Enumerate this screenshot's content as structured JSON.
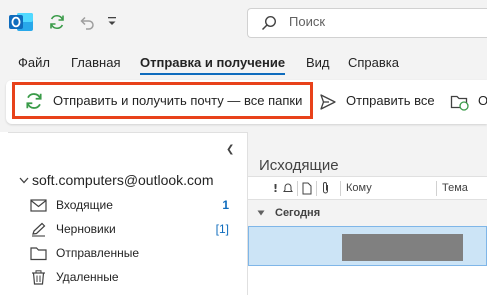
{
  "colors": {
    "accent": "#0f6cbd",
    "highlight": "#e8411a",
    "selection": "#cce4f6",
    "sync_green": "#3a9b49",
    "outlook_blue": "#0f6cbd"
  },
  "titlebar": {
    "icons": [
      "outlook-logo-icon",
      "sync-icon",
      "undo-icon",
      "customize-toolbar-icon"
    ],
    "search_placeholder": "Поиск"
  },
  "menu": {
    "tabs": [
      {
        "label": "Файл",
        "active": false
      },
      {
        "label": "Главная",
        "active": false
      },
      {
        "label": "Отправка и получение",
        "active": true
      },
      {
        "label": "Вид",
        "active": false
      },
      {
        "label": "Справка",
        "active": false
      }
    ]
  },
  "ribbon": {
    "send_receive_all": "Отправить и получить почту — все папки",
    "send_all": "Отправить все",
    "update_folder": "О"
  },
  "nav": {
    "account": "soft.computers@outlook.com",
    "folders": [
      {
        "label": "Входящие",
        "count": "1",
        "icon": "envelope-icon"
      },
      {
        "label": "Черновики",
        "count": "[1]",
        "icon": "pencil-icon"
      },
      {
        "label": "Отправленные",
        "count": "",
        "icon": "folder-icon"
      },
      {
        "label": "Удаленные",
        "count": "",
        "icon": "trash-icon"
      }
    ]
  },
  "mail": {
    "folder_title": "Исходящие",
    "columns": {
      "to": "Кому",
      "subject": "Тема"
    },
    "column_icons": [
      "importance-icon",
      "reminder-icon",
      "document-icon",
      "attachment-icon"
    ],
    "group_label": "Сегодня"
  }
}
